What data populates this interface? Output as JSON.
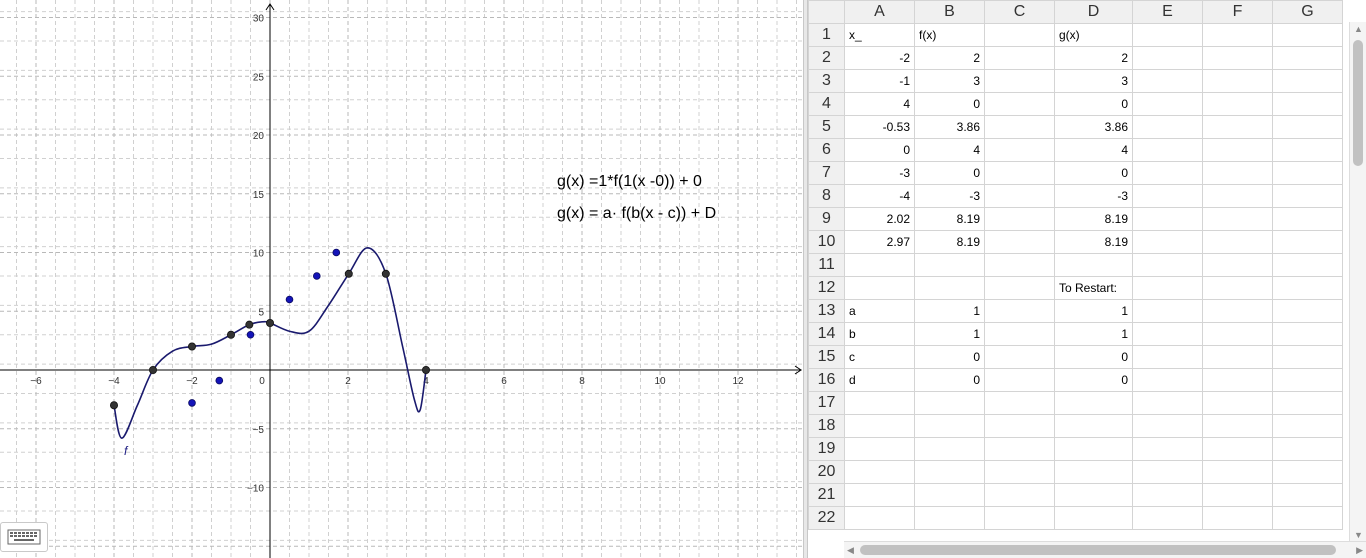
{
  "graphics": {
    "formula_1": "g(x) =1*f(1(x -0)) + 0",
    "formula_2": "g(x) = a· f(b(x - c)) + D",
    "curve_label": "f",
    "x_ticks": [
      "−6",
      "−4",
      "−2",
      "0",
      "2",
      "4",
      "6",
      "8",
      "10",
      "12"
    ],
    "y_ticks": [
      "30",
      "25",
      "20",
      "15",
      "10",
      "5",
      "−5",
      "−10"
    ],
    "black_points": [
      [
        -4,
        -3
      ],
      [
        -3,
        0
      ],
      [
        -1,
        3
      ],
      [
        -0.53,
        3.86
      ],
      [
        0,
        4
      ],
      [
        -2,
        2
      ],
      [
        2.02,
        8.19
      ],
      [
        2.97,
        8.19
      ],
      [
        4,
        0
      ]
    ],
    "blue_points": [
      [
        -2,
        -2.8
      ],
      [
        -1.3,
        -0.9
      ],
      [
        -0.5,
        3
      ],
      [
        0.5,
        6
      ],
      [
        1.2,
        8
      ],
      [
        1.7,
        10
      ]
    ],
    "axis_color": "#000000",
    "curve_color": "#1a1a6e",
    "blue_point_color": "#1414b8",
    "black_point_color": "#333333"
  },
  "spreadsheet": {
    "columns": [
      "A",
      "B",
      "C",
      "D",
      "E",
      "F",
      "G"
    ],
    "rows": [
      {
        "n": "1",
        "A": "x_",
        "B": "f(x)",
        "C": "",
        "D": "g(x)"
      },
      {
        "n": "2",
        "A": "-2",
        "B": "2",
        "C": "",
        "D": "2"
      },
      {
        "n": "3",
        "A": "-1",
        "B": "3",
        "C": "",
        "D": "3"
      },
      {
        "n": "4",
        "A": "4",
        "B": "0",
        "C": "",
        "D": "0"
      },
      {
        "n": "5",
        "A": "-0.53",
        "B": "3.86",
        "C": "",
        "D": "3.86"
      },
      {
        "n": "6",
        "A": "0",
        "B": "4",
        "C": "",
        "D": "4"
      },
      {
        "n": "7",
        "A": "-3",
        "B": "0",
        "C": "",
        "D": "0"
      },
      {
        "n": "8",
        "A": "-4",
        "B": "-3",
        "C": "",
        "D": "-3"
      },
      {
        "n": "9",
        "A": "2.02",
        "B": "8.19",
        "C": "",
        "D": "8.19"
      },
      {
        "n": "10",
        "A": "2.97",
        "B": "8.19",
        "C": "",
        "D": "8.19"
      },
      {
        "n": "11",
        "A": "",
        "B": "",
        "C": "",
        "D": ""
      },
      {
        "n": "12",
        "A": "",
        "B": "",
        "C": "",
        "D": "To Restart:"
      },
      {
        "n": "13",
        "A": "a",
        "B": "1",
        "C": "",
        "D": "1"
      },
      {
        "n": "14",
        "A": "b",
        "B": "1",
        "C": "",
        "D": "1"
      },
      {
        "n": "15",
        "A": "c",
        "B": "0",
        "C": "",
        "D": "0"
      },
      {
        "n": "16",
        "A": "d",
        "B": "0",
        "C": "",
        "D": "0"
      },
      {
        "n": "17",
        "A": "",
        "B": "",
        "C": "",
        "D": ""
      },
      {
        "n": "18",
        "A": "",
        "B": "",
        "C": "",
        "D": ""
      },
      {
        "n": "19",
        "A": "",
        "B": "",
        "C": "",
        "D": ""
      },
      {
        "n": "20",
        "A": "",
        "B": "",
        "C": "",
        "D": ""
      },
      {
        "n": "21",
        "A": "",
        "B": "",
        "C": "",
        "D": ""
      },
      {
        "n": "22",
        "A": "",
        "B": "",
        "C": "",
        "D": ""
      }
    ],
    "text_color_blue": "#1a1aa6",
    "text_color_red": "#cc1f4a"
  },
  "icons": {
    "keyboard": "keyboard-icon",
    "scroll_up": "scroll-up-arrow-icon",
    "scroll_down": "scroll-down-arrow-icon",
    "scroll_left": "scroll-left-arrow-icon",
    "scroll_right": "scroll-right-arrow-icon"
  }
}
